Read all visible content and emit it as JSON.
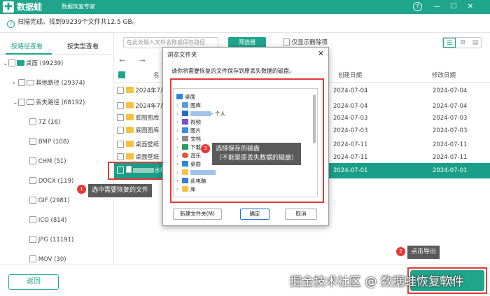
{
  "titlebar": {
    "logo_symbol": "✚",
    "app_name": "数据蛙",
    "app_subtitle": "数据恢复专家",
    "help": "?",
    "min": "—",
    "max": "☐",
    "close": "✕"
  },
  "status": {
    "text": "扫描完成。找到99239个文件共12.5 GB。"
  },
  "left_tabs": {
    "by_path": "按路径查看",
    "by_type": "按类型查看"
  },
  "tree": [
    {
      "label": "桌面 (99239)",
      "chev": "⌄"
    },
    {
      "label": "其他路径 (29374)",
      "chev": "›"
    },
    {
      "label": "丢失路径 (68192)",
      "chev": "⌄"
    },
    {
      "label": "7Z (16)"
    },
    {
      "label": "BMP (108)"
    },
    {
      "label": "CHM (51)"
    },
    {
      "label": "DOCX (119)"
    },
    {
      "label": "GIF (2981)"
    },
    {
      "label": "ICO (814)"
    },
    {
      "label": "JPG (11191)"
    },
    {
      "label": "MOV (30)"
    }
  ],
  "toolbar": {
    "search_placeholder": "在此处输入文件名称或保存路径",
    "filter_label": "筛选器",
    "show_deleted_label": "仅显示删除项",
    "view_list": "☰",
    "view_grid": "⊞",
    "view_detail": "▤",
    "nav_back": "←",
    "nav_forward": "→"
  },
  "table": {
    "headers": {
      "name": "名",
      "created": "创建日期",
      "modified": "修改日期"
    },
    "rows": [
      {
        "name": "2024年7月",
        "created": "2024-07-04",
        "modified": "2024-07-04"
      },
      {
        "name": "2024年7月",
        "created": "2024-07-04",
        "modified": "2024-07-04"
      },
      {
        "name": "底图图库",
        "created": "2024-07-03",
        "modified": "2024-07-03"
      },
      {
        "name": "底图图库",
        "created": "2024-07-03",
        "modified": "2024-07-03"
      },
      {
        "name": "桌面壁纸",
        "created": "2024-07-11",
        "modified": "2024-07-11"
      },
      {
        "name": "桌面壁纸",
        "created": "2024-07-11",
        "modified": "2024-07-11"
      },
      {
        "name": "水印",
        "created": "2024-07-01",
        "modified": "2024-07-01"
      }
    ]
  },
  "dialog": {
    "title": "浏览文件夹",
    "close": "✕",
    "instruction": "请你将需要恢复的文件保存到原丢失数据的磁盘。",
    "tree": [
      {
        "label": "桌面",
        "arrow": ""
      },
      {
        "label": "图库",
        "arrow": "›"
      },
      {
        "label": "- 个人",
        "arrow": "›"
      },
      {
        "label": "视频",
        "arrow": "›"
      },
      {
        "label": "图片",
        "arrow": "›"
      },
      {
        "label": "文档",
        "arrow": "›"
      },
      {
        "label": "下载",
        "arrow": "›"
      },
      {
        "label": "音乐",
        "arrow": "›"
      },
      {
        "label": "桌面",
        "arrow": "›"
      },
      {
        "label": "",
        "arrow": "›"
      },
      {
        "label": "此电脑",
        "arrow": "›"
      },
      {
        "label": "库",
        "arrow": "›"
      }
    ],
    "new_folder": "新建文件夹(M)",
    "ok": "确定",
    "cancel": "取消"
  },
  "annotations": {
    "n1": "1",
    "a1": "选中需要恢复的文件",
    "n2": "2",
    "a2": "点击导出",
    "n3": "3",
    "a3_line1": "选择保存的磁盘",
    "a3_line2": "（不能是原丢失数据的磁盘）"
  },
  "bottom": {
    "back": "返回",
    "export": "导出",
    "watermark": "掘金技术社区 @ 数据蛙恢复软件"
  },
  "colors": {
    "accent": "#1fa58c",
    "selected_row": "#1a9e87",
    "annotation_red": "#e53935"
  }
}
